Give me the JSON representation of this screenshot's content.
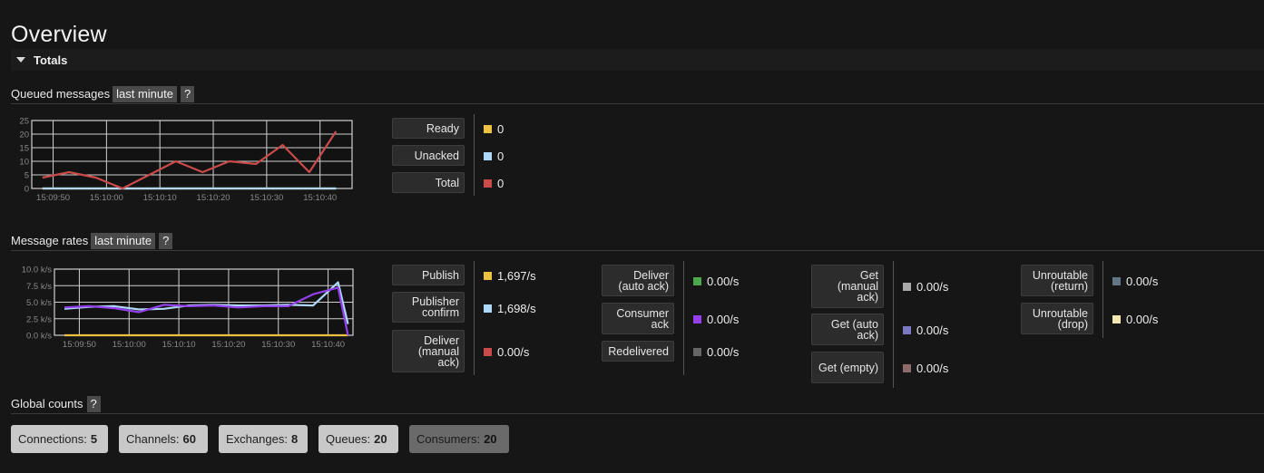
{
  "page_title": "Overview",
  "totals_label": "Totals",
  "queued": {
    "title": "Queued messages",
    "range": "last minute",
    "help": "?",
    "y_ticks": [
      "25",
      "20",
      "15",
      "10",
      "5",
      "0"
    ],
    "x_ticks": [
      "15:09:50",
      "15:10:00",
      "15:10:10",
      "15:10:20",
      "15:10:30",
      "15:10:40"
    ],
    "legend": [
      {
        "label": "Ready",
        "value": "0",
        "color": "#edc240"
      },
      {
        "label": "Unacked",
        "value": "0",
        "color": "#afd8f8"
      },
      {
        "label": "Total",
        "value": "0",
        "color": "#cb4b4b"
      }
    ]
  },
  "rates": {
    "title": "Message rates",
    "range": "last minute",
    "help": "?",
    "y_ticks": [
      "10.0 k/s",
      "7.5 k/s",
      "5.0 k/s",
      "2.5 k/s",
      "0.0 k/s"
    ],
    "x_ticks": [
      "15:09:50",
      "15:10:00",
      "15:10:10",
      "15:10:20",
      "15:10:30",
      "15:10:40"
    ],
    "col1": [
      {
        "label": "Publish",
        "value": "1,697/s",
        "color": "#edc240"
      },
      {
        "label": "Publisher confirm",
        "value": "1,698/s",
        "color": "#afd8f8"
      },
      {
        "label": "Deliver (manual ack)",
        "value": "0.00/s",
        "color": "#cb4b4b"
      }
    ],
    "col2": [
      {
        "label": "Deliver (auto ack)",
        "value": "0.00/s",
        "color": "#4da74d"
      },
      {
        "label": "Consumer ack",
        "value": "0.00/s",
        "color": "#9440ed"
      },
      {
        "label": "Redelivered",
        "value": "0.00/s",
        "color": "#666666"
      }
    ],
    "col3": [
      {
        "label": "Get (manual ack)",
        "value": "0.00/s",
        "color": "#aaaaaa"
      },
      {
        "label": "Get (auto ack)",
        "value": "0.00/s",
        "color": "#7c79c3"
      },
      {
        "label": "Get (empty)",
        "value": "0.00/s",
        "color": "#8d6b6b"
      }
    ],
    "col4": [
      {
        "label": "Unroutable (return)",
        "value": "0.00/s",
        "color": "#637686"
      },
      {
        "label": "Unroutable (drop)",
        "value": "0.00/s",
        "color": "#f3e8b0"
      }
    ]
  },
  "global": {
    "title": "Global counts",
    "help": "?",
    "counts": [
      {
        "label": "Connections:",
        "value": "5"
      },
      {
        "label": "Channels:",
        "value": "60"
      },
      {
        "label": "Exchanges:",
        "value": "8"
      },
      {
        "label": "Queues:",
        "value": "20"
      },
      {
        "label": "Consumers:",
        "value": "20"
      }
    ]
  },
  "chart_data": [
    {
      "type": "line",
      "title": "Queued messages",
      "x": [
        "15:09:48",
        "15:09:53",
        "15:09:58",
        "15:10:03",
        "15:10:08",
        "15:10:13",
        "15:10:18",
        "15:10:23",
        "15:10:28",
        "15:10:33",
        "15:10:38",
        "15:10:43"
      ],
      "ylim": [
        0,
        25
      ],
      "series": [
        {
          "name": "Ready",
          "color": "#edc240",
          "values": [
            0,
            0,
            0,
            0,
            0,
            0,
            0,
            0,
            0,
            0,
            0,
            0
          ]
        },
        {
          "name": "Unacked",
          "color": "#afd8f8",
          "values": [
            0,
            0,
            0,
            0,
            0,
            0,
            0,
            0,
            0,
            0,
            0,
            0
          ]
        },
        {
          "name": "Total",
          "color": "#cb4b4b",
          "values": [
            4,
            6,
            4,
            0,
            5,
            10,
            6,
            10,
            9,
            16,
            6,
            21
          ]
        }
      ]
    },
    {
      "type": "line",
      "title": "Message rates",
      "x": [
        "15:09:47",
        "15:09:52",
        "15:09:57",
        "15:10:02",
        "15:10:07",
        "15:10:12",
        "15:10:17",
        "15:10:22",
        "15:10:27",
        "15:10:32",
        "15:10:37",
        "15:10:42",
        "15:10:44"
      ],
      "ylim": [
        0,
        10
      ],
      "series": [
        {
          "name": "Publish",
          "color": "#edc240",
          "values": [
            0,
            0,
            0,
            0,
            0,
            0,
            0,
            0,
            0,
            0,
            0,
            0,
            0
          ]
        },
        {
          "name": "Publisher confirm",
          "color": "#afd8f8",
          "values": [
            4.0,
            4.3,
            4.4,
            3.9,
            4.0,
            4.5,
            4.6,
            4.5,
            4.5,
            4.6,
            4.5,
            8.0,
            1.7
          ]
        },
        {
          "name": "Consumer ack",
          "color": "#9440ed",
          "values": [
            4.2,
            4.4,
            4.1,
            3.5,
            4.6,
            4.4,
            4.5,
            4.2,
            4.4,
            4.4,
            6.2,
            7.2,
            0.0
          ]
        }
      ]
    }
  ]
}
